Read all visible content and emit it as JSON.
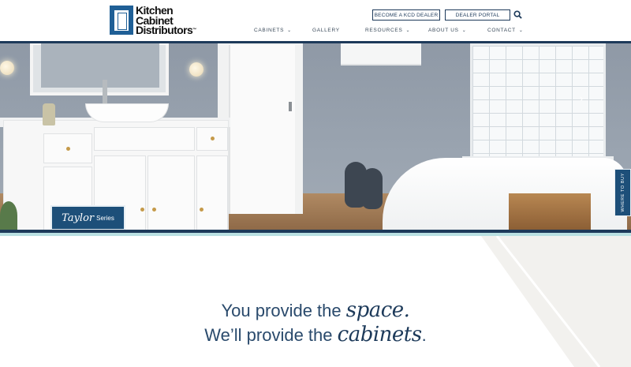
{
  "header": {
    "logo": {
      "line1": "Kitchen",
      "line2": "Cabinet",
      "line3": "Distributors",
      "trademark": "™"
    },
    "buttons": {
      "become_dealer": "BECOME A KCD DEALER",
      "dealer_portal": "DEALER PORTAL"
    },
    "search_icon": "search-icon",
    "nav": [
      {
        "label": "CABINETS",
        "has_dropdown": true
      },
      {
        "label": "GALLERY",
        "has_dropdown": false
      },
      {
        "label": "RESOURCES",
        "has_dropdown": true
      },
      {
        "label": "ABOUT US",
        "has_dropdown": true
      },
      {
        "label": "CONTACT",
        "has_dropdown": true
      }
    ]
  },
  "hero": {
    "series": {
      "name": "Taylor",
      "suffix": "Series"
    },
    "next_arrow": "chevron-right-icon",
    "where_to_buy": "WHERE TO BUY"
  },
  "tagline": {
    "line1_prefix": "You provide the",
    "line1_script": "space.",
    "line2_prefix": "We’ll provide the",
    "line2_script": "cabinets",
    "line2_suffix": "."
  },
  "colors": {
    "navy": "#1d3a5a",
    "brand_blue": "#1d4f79",
    "teal_band": "#b9e0e2",
    "knob_gold": "#c59a4a"
  }
}
